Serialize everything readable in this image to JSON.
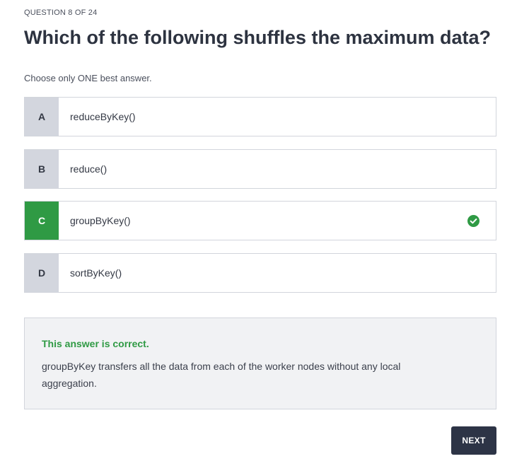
{
  "question": {
    "counter": "QUESTION 8 OF 24",
    "title": "Which of the following shuffles the maximum data?",
    "instruction": "Choose only ONE best answer."
  },
  "options": [
    {
      "letter": "A",
      "text": "reduceByKey()",
      "selected": false
    },
    {
      "letter": "B",
      "text": "reduce()",
      "selected": false
    },
    {
      "letter": "C",
      "text": "groupByKey()",
      "selected": true,
      "icon": "check-circle-icon"
    },
    {
      "letter": "D",
      "text": "sortByKey()",
      "selected": false
    }
  ],
  "feedback": {
    "title": "This answer is correct.",
    "body": "groupByKey transfers all the data from each of the worker nodes without any local aggregation."
  },
  "buttons": {
    "next_label": "NEXT"
  },
  "colors": {
    "correct_green": "#2f9a44",
    "letter_bg": "#d3d6de",
    "button_dark": "#2d3446",
    "feedback_bg": "#f1f2f4"
  }
}
